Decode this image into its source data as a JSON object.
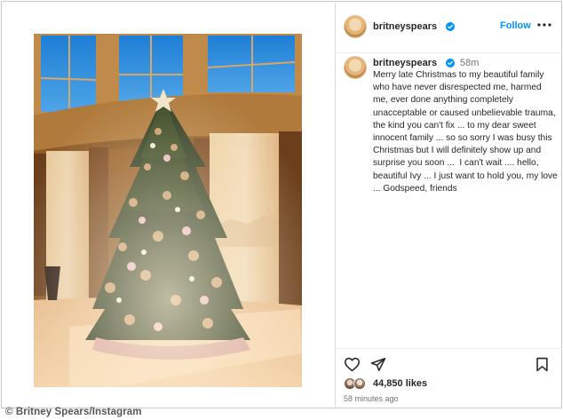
{
  "post": {
    "username": "britneyspears",
    "follow_label": "Follow",
    "time": "58m",
    "caption": "Merry late Christmas to my beautiful family who have never disrespected me, harmed me, ever done anything completely unacceptable or caused unbelievable trauma, the kind you can't fix ... to my dear sweet innocent family ... so so sorry I was busy this Christmas but I will definitely show up and surprise you soon ...  I can't wait .... hello, beautiful Ivy ... I just want to hold you, my love ... Godspeed, friends",
    "likes": "44,850 likes",
    "posted_ago": "58 minutes ago"
  },
  "icons": {
    "verified": "verified-badge-icon",
    "more": "more-options-icon",
    "like": "heart-icon",
    "share": "share-icon",
    "save": "bookmark-icon"
  },
  "colors": {
    "accent": "#0095f6",
    "verified": "#0095f6",
    "muted": "#737373"
  },
  "credit": "© Britney Spears/Instagram"
}
